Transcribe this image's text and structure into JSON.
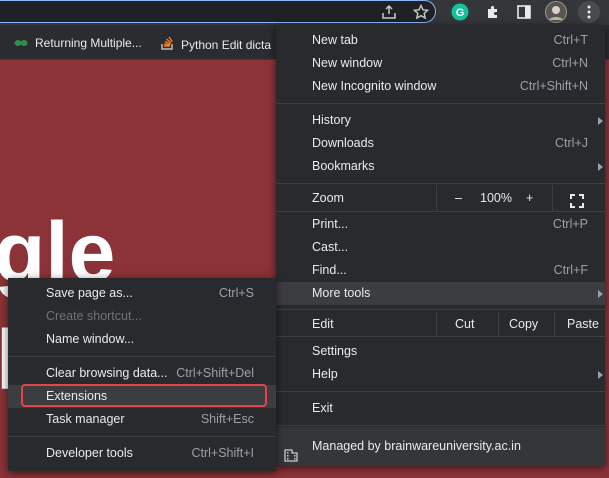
{
  "toolbar": {
    "icons": [
      "share-icon",
      "star-icon",
      "grammarly-icon",
      "extensions-puzzle-icon",
      "side-panel-icon",
      "profile-avatar",
      "kebab-menu-icon"
    ]
  },
  "bookmarks": [
    {
      "label": "Returning Multiple...",
      "icon": "bookmark-site-icon"
    },
    {
      "label": "Python Edit dicta",
      "icon": "stackoverflow-icon"
    }
  ],
  "page": {
    "big_text_1": "gle",
    "big_text_2": "l"
  },
  "main_menu": {
    "new_tab": {
      "label": "New tab",
      "accel": "Ctrl+T"
    },
    "new_window": {
      "label": "New window",
      "accel": "Ctrl+N"
    },
    "new_incognito": {
      "label": "New Incognito window",
      "accel": "Ctrl+Shift+N"
    },
    "history": {
      "label": "History"
    },
    "downloads": {
      "label": "Downloads",
      "accel": "Ctrl+J"
    },
    "bookmarks": {
      "label": "Bookmarks"
    },
    "zoom": {
      "label": "Zoom",
      "minus": "–",
      "value": "100%",
      "plus": "+"
    },
    "print": {
      "label": "Print...",
      "accel": "Ctrl+P"
    },
    "cast": {
      "label": "Cast..."
    },
    "find": {
      "label": "Find...",
      "accel": "Ctrl+F"
    },
    "more_tools": {
      "label": "More tools"
    },
    "edit": {
      "label": "Edit",
      "cut": "Cut",
      "copy": "Copy",
      "paste": "Paste"
    },
    "settings": {
      "label": "Settings"
    },
    "help": {
      "label": "Help"
    },
    "exit": {
      "label": "Exit"
    },
    "managed": {
      "label": "Managed by brainwareuniversity.ac.in"
    }
  },
  "sub_menu": {
    "save_page": {
      "label": "Save page as...",
      "accel": "Ctrl+S"
    },
    "create_shortcut": {
      "label": "Create shortcut..."
    },
    "name_window": {
      "label": "Name window..."
    },
    "clear_data": {
      "label": "Clear browsing data...",
      "accel": "Ctrl+Shift+Del"
    },
    "extensions": {
      "label": "Extensions"
    },
    "task_manager": {
      "label": "Task manager",
      "accel": "Shift+Esc"
    },
    "dev_tools": {
      "label": "Developer tools",
      "accel": "Ctrl+Shift+I"
    }
  },
  "colors": {
    "highlight_box": "#e8424c",
    "page_bg": "#8b3338",
    "menu_bg": "#292a2d"
  }
}
